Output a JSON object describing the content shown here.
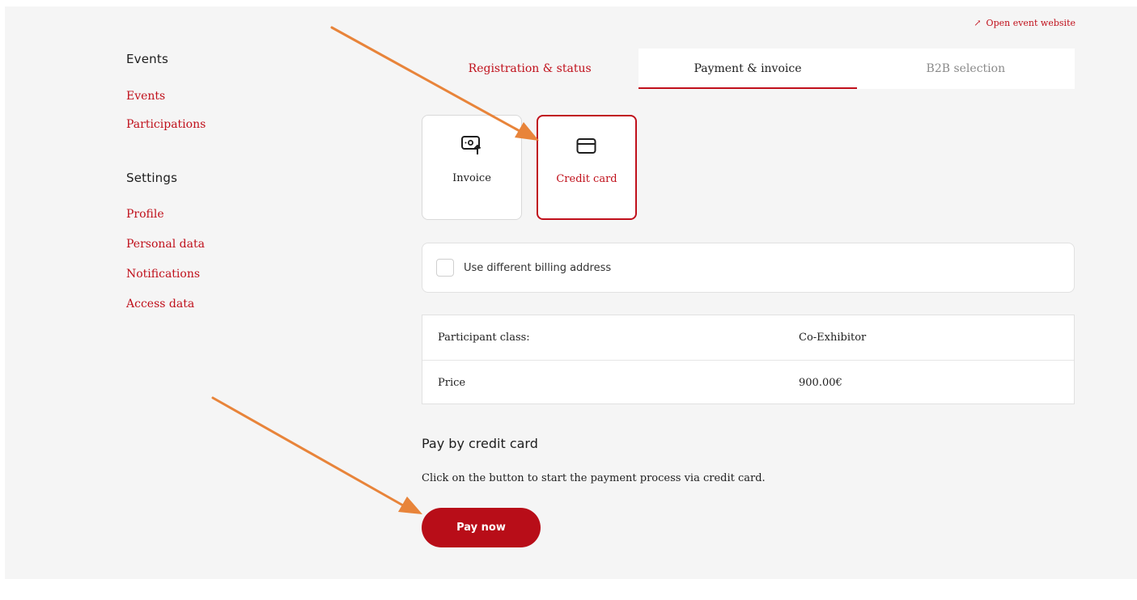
{
  "header": {
    "open_event_link": "Open event website",
    "open_event_icon": "external-arrow-icon"
  },
  "sidebar": {
    "events_heading": "Events",
    "events_items": [
      {
        "label": "Events"
      },
      {
        "label": "Participations"
      }
    ],
    "settings_heading": "Settings",
    "settings_items": [
      {
        "label": "Profile"
      },
      {
        "label": "Personal data"
      },
      {
        "label": "Notifications"
      },
      {
        "label": "Access data"
      }
    ]
  },
  "tabs": [
    {
      "label": "Registration & status"
    },
    {
      "label": "Payment & invoice"
    },
    {
      "label": "B2B selection"
    }
  ],
  "payment_methods": [
    {
      "label": "Invoice",
      "icon": "money-upload-icon"
    },
    {
      "label": "Credit card",
      "icon": "credit-card-icon"
    }
  ],
  "billing": {
    "checkbox_label": "Use different billing address"
  },
  "info_table": [
    {
      "label": "Participant class:",
      "value": "Co-Exhibitor"
    },
    {
      "label": "Price",
      "value": "900.00€"
    }
  ],
  "pay_section": {
    "title": "Pay by credit card",
    "description": "Click on the button to start the payment process via credit card.",
    "button_label": "Pay now"
  },
  "colors": {
    "accent": "#c0101b",
    "button": "#b80d18",
    "annotation_arrow": "#e8843a",
    "page_bg": "#f5f5f5"
  }
}
